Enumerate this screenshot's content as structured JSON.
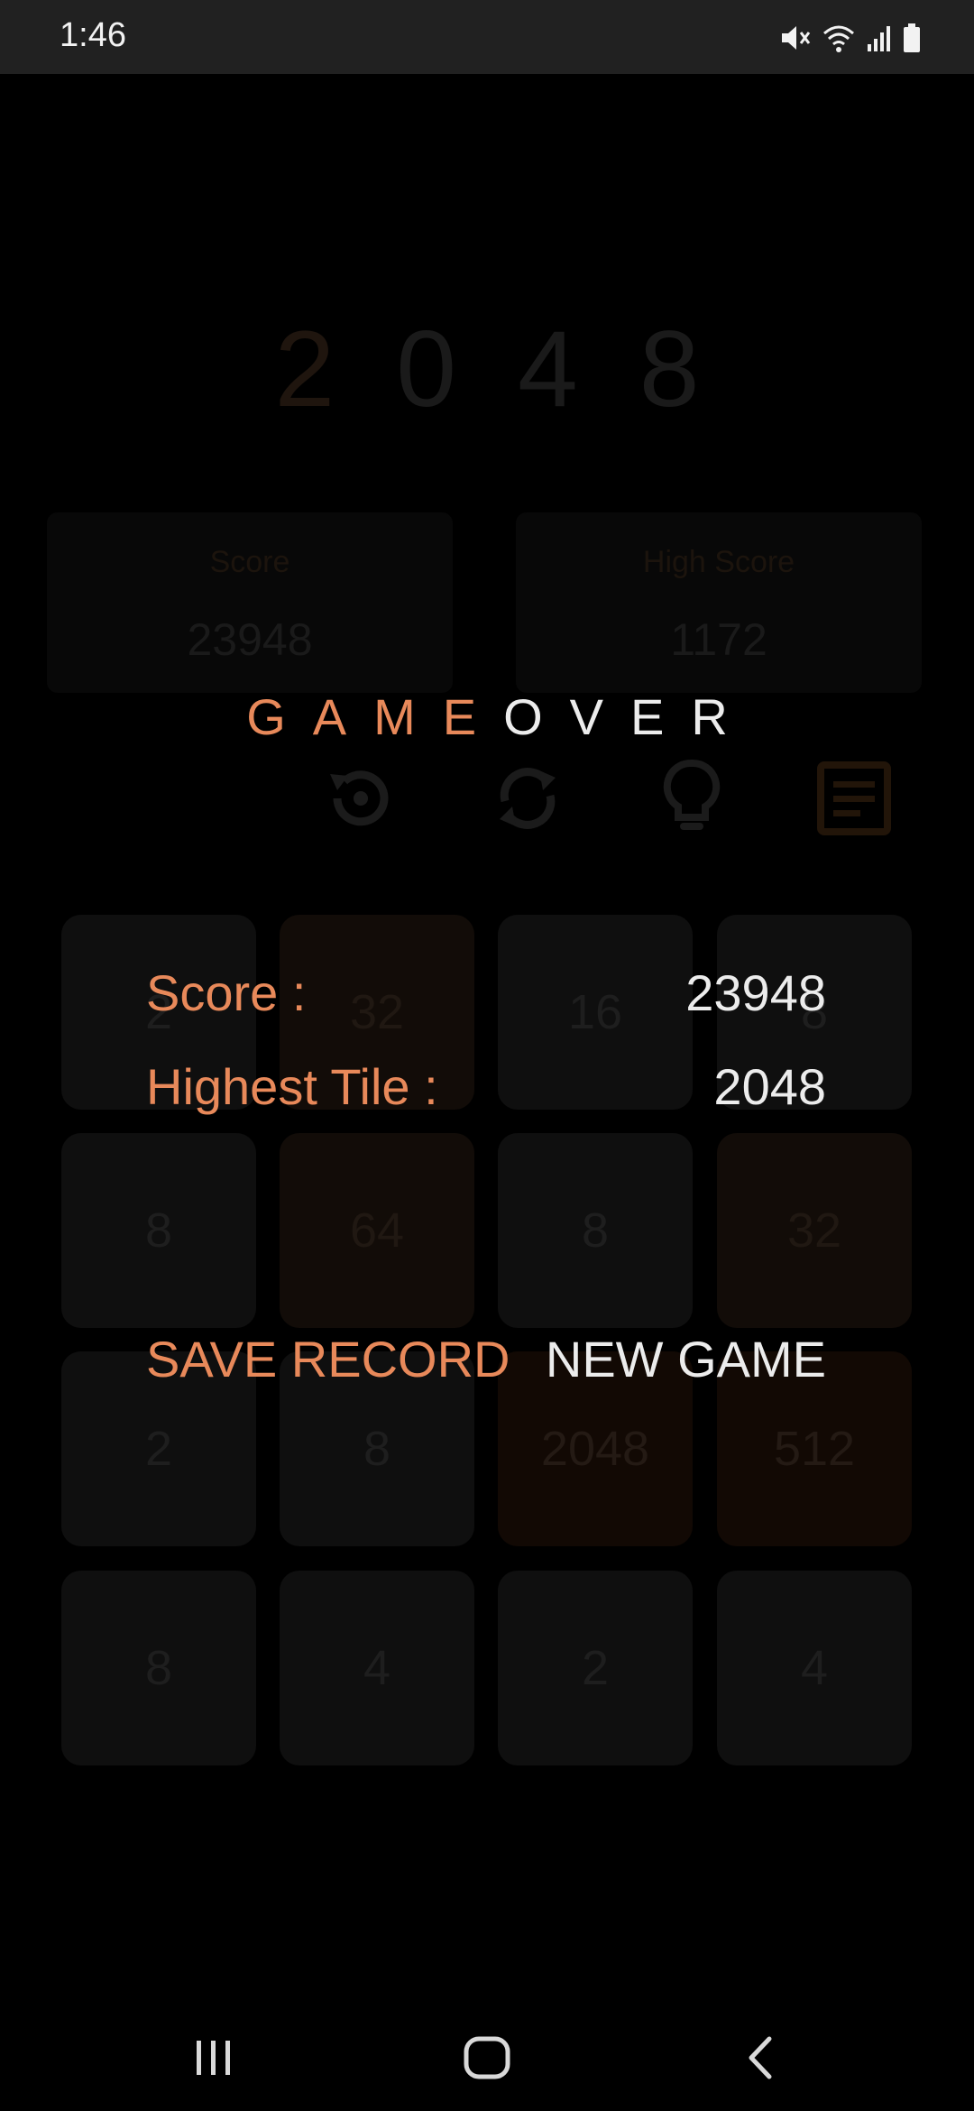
{
  "status_bar": {
    "time": "1:46",
    "icons": [
      "mute-icon",
      "wifi-icon",
      "signal-icon",
      "battery-icon"
    ]
  },
  "background": {
    "logo_digits": [
      "2",
      "0",
      "4",
      "8"
    ],
    "score_card": {
      "label": "Score",
      "value": "23948"
    },
    "high_score_card": {
      "label": "High Score",
      "value": "1172"
    },
    "toolbar_icons": [
      "undo-icon",
      "restart-icon",
      "hint-icon",
      "records-icon"
    ],
    "tiles": [
      [
        "2",
        "32",
        "16",
        "8"
      ],
      [
        "8",
        "64",
        "8",
        "32"
      ],
      [
        "2",
        "8",
        "2048",
        "512"
      ],
      [
        "8",
        "4",
        "2",
        "4"
      ]
    ]
  },
  "overlay": {
    "title_game": "GAME",
    "title_over": "OVER",
    "score_label": "Score :",
    "score_value": "23948",
    "highest_tile_label": "Highest Tile :",
    "highest_tile_value": "2048",
    "save_button": "SAVE RECORD",
    "new_game_button": "NEW GAME"
  },
  "colors": {
    "accent": "#e8895a",
    "text_light": "#ececec",
    "status_bar_bg": "#212121",
    "background": "#000000"
  },
  "nav_bar": {
    "buttons": [
      "recent-apps-icon",
      "home-icon",
      "back-icon"
    ]
  }
}
